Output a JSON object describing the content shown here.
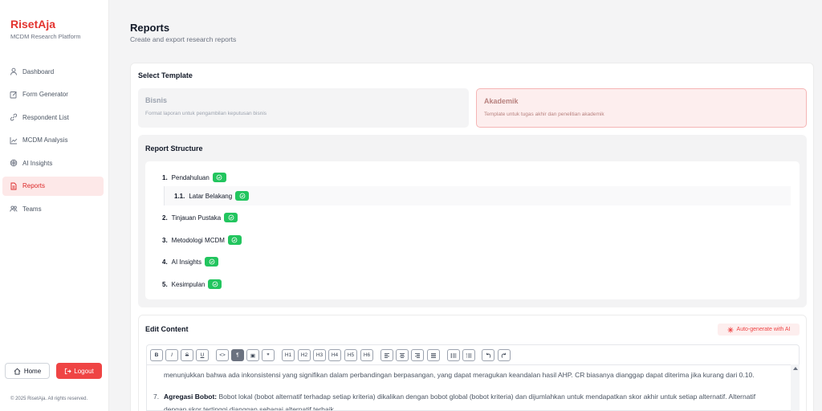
{
  "brand": {
    "name": "RisetAja",
    "tagline": "MCDM Research Platform"
  },
  "sidebar": {
    "items": [
      {
        "label": "Dashboard",
        "icon": "user-icon"
      },
      {
        "label": "Form Generator",
        "icon": "edit-icon"
      },
      {
        "label": "Respondent List",
        "icon": "link-icon"
      },
      {
        "label": "MCDM Analysis",
        "icon": "chart-line-icon"
      },
      {
        "label": "AI Insights",
        "icon": "brain-icon"
      },
      {
        "label": "Reports",
        "icon": "document-icon",
        "active": true
      },
      {
        "label": "Teams",
        "icon": "users-icon"
      }
    ],
    "home_label": "Home",
    "logout_label": "Logout",
    "copyright": "© 2025 RisetAja. All rights reserved."
  },
  "header": {
    "title": "Reports",
    "subtitle": "Create and export research reports"
  },
  "templates": {
    "title": "Select Template",
    "items": [
      {
        "name": "Bisnis",
        "description": "Format laporan untuk pengambilan keputusan bisnis",
        "selected": false
      },
      {
        "name": "Akademik",
        "description": "Template untuk tugas akhir dan penelitian akademik",
        "selected": true
      }
    ]
  },
  "structure": {
    "title": "Report Structure",
    "items": [
      {
        "num": "1.",
        "label": "Pendahuluan"
      },
      {
        "num": "1.1.",
        "label": "Latar Belakang"
      },
      {
        "num": "2.",
        "label": "Tinjauan Pustaka"
      },
      {
        "num": "3.",
        "label": "Metodologi MCDM"
      },
      {
        "num": "4.",
        "label": "AI Insights"
      },
      {
        "num": "5.",
        "label": "Kesimpulan"
      }
    ]
  },
  "edit": {
    "title": "Edit Content",
    "ai_button": "Auto-generate with AI",
    "toolbar": [
      "B",
      "I",
      "S",
      "U",
      "<>",
      "¶",
      "▣",
      "❞",
      "H1",
      "H2",
      "H3",
      "H4",
      "H5",
      "H6"
    ],
    "content_line1": "menunjukkan bahwa ada inkonsistensi yang signifikan dalam perbandingan berpasangan, yang dapat meragukan keandalan hasil AHP. CR biasanya dianggap dapat diterima jika kurang dari 0.10.",
    "item7_num": "7.",
    "item7_bold": "Agregasi Bobot:",
    "item7_text": " Bobot lokal (bobot alternatif terhadap setiap kriteria) dikalikan dengan bobot global (bobot kriteria) dan dijumlahkan untuk mendapatkan skor akhir untuk setiap alternatif. Alternatif",
    "item7_line2": "dengan skor tertinggi dianggap sebagai alternatif terbaik."
  },
  "colors": {
    "accent": "#ef4444",
    "success": "#22c55e",
    "active_bg": "#fde8e8"
  }
}
